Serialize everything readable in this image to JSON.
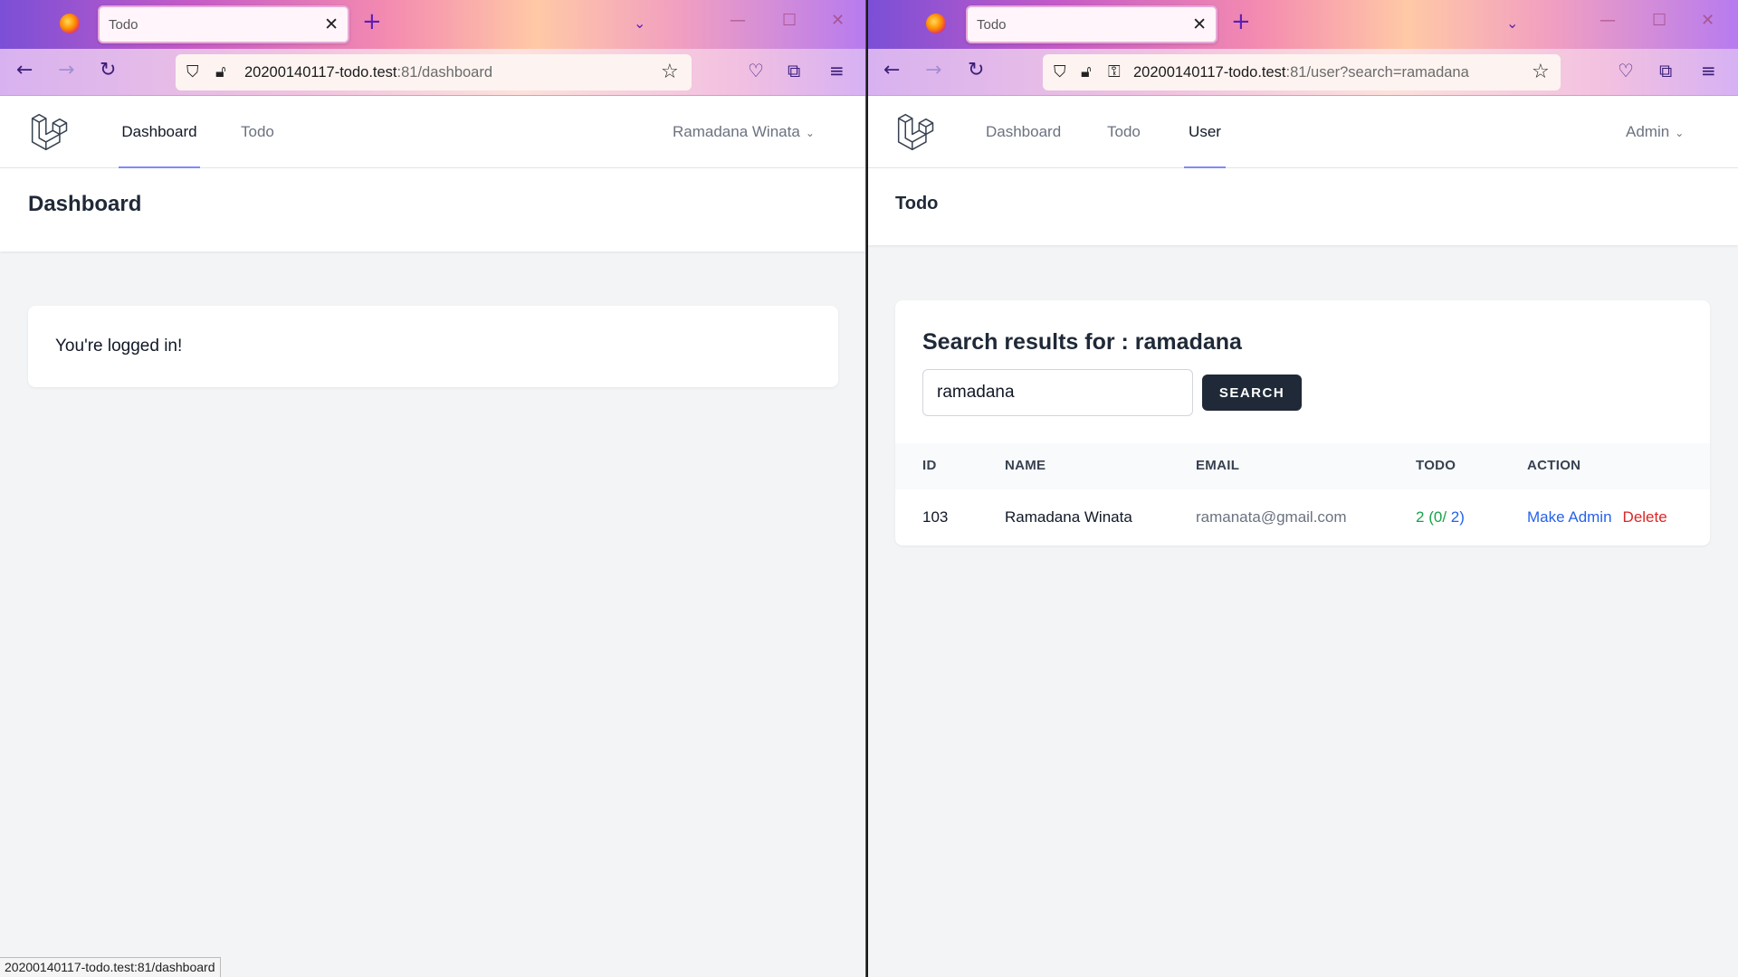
{
  "left": {
    "tab_title": "Todo",
    "url_host": "20200140117-todo.test",
    "url_path": ":81/dashboard",
    "nav": {
      "dashboard": "Dashboard",
      "todo": "Todo"
    },
    "user_menu": "Ramadana Winata",
    "page_title": "Dashboard",
    "message": "You're logged in!",
    "status_bar": "20200140117-todo.test:81/dashboard"
  },
  "right": {
    "tab_title": "Todo",
    "url_host": "20200140117-todo.test",
    "url_path": ":81/user?search=ramadana",
    "nav": {
      "dashboard": "Dashboard",
      "todo": "Todo",
      "user": "User"
    },
    "user_menu": "Admin",
    "page_title": "Todo",
    "search": {
      "title": "Search results for : ramadana",
      "value": "ramadana",
      "button": "SEARCH"
    },
    "table": {
      "headers": {
        "id": "ID",
        "name": "NAME",
        "email": "EMAIL",
        "todo": "TODO",
        "action": "ACTION"
      },
      "rows": [
        {
          "id": "103",
          "name": "Ramadana Winata",
          "email": "ramanata@gmail.com",
          "todo_total": "2",
          "todo_done": "(0/",
          "todo_all": "2)",
          "make_admin": "Make Admin",
          "delete": "Delete"
        }
      ]
    }
  },
  "colors": {
    "accent_indigo": "#818cf8",
    "button_dark": "#1f2937",
    "link_blue": "#2563eb",
    "delete_red": "#dc2626",
    "done_green": "#16a34a"
  }
}
